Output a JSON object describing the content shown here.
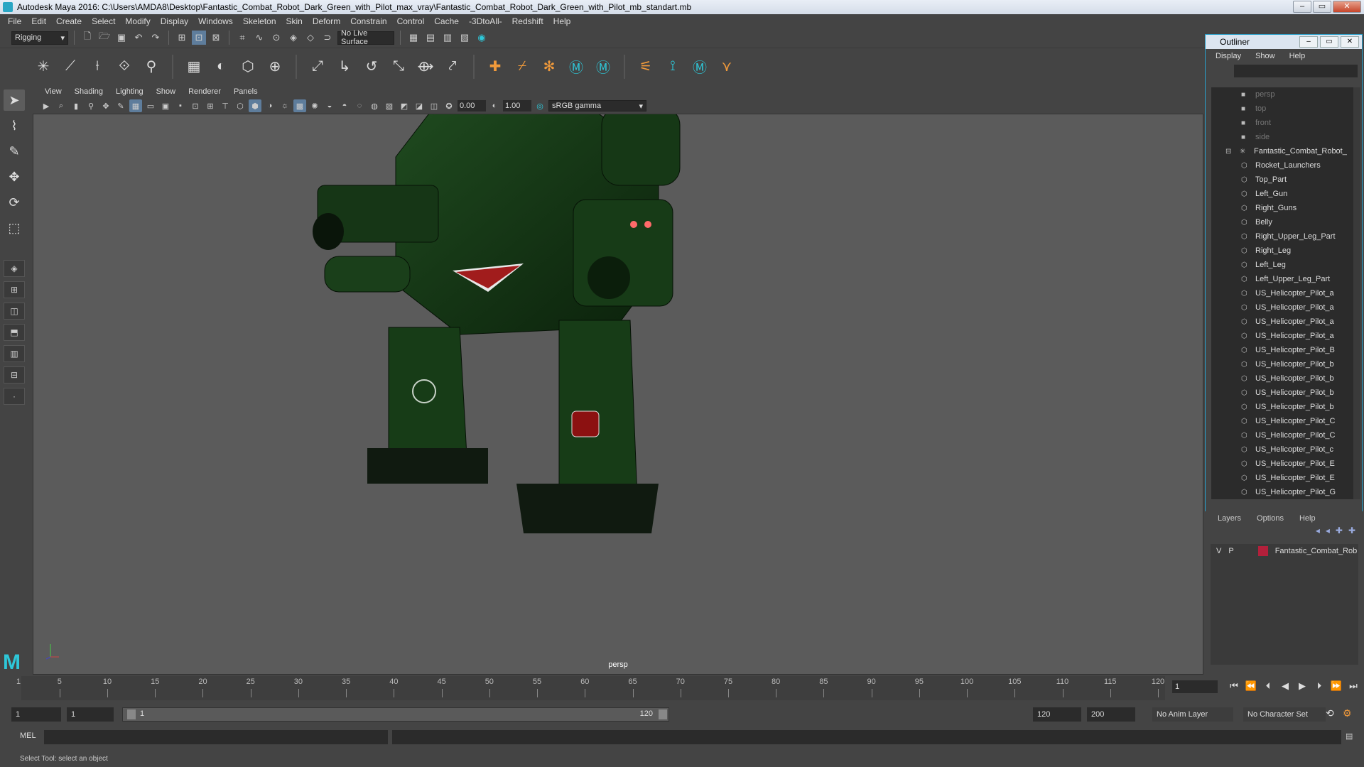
{
  "window": {
    "title": "Autodesk Maya 2016: C:\\Users\\AMDA8\\Desktop\\Fantastic_Combat_Robot_Dark_Green_with_Pilot_max_vray\\Fantastic_Combat_Robot_Dark_Green_with_Pilot_mb_standart.mb",
    "btn_min": "–",
    "btn_max": "▭",
    "btn_close": "✕"
  },
  "menubar": {
    "items": [
      "File",
      "Edit",
      "Create",
      "Select",
      "Modify",
      "Display",
      "Windows",
      "Skeleton",
      "Skin",
      "Deform",
      "Constrain",
      "Control",
      "Cache",
      "-3DtoAll-",
      "Redshift",
      "Help"
    ]
  },
  "statusline": {
    "menuset": "Rigging",
    "live_surface": "No Live Surface"
  },
  "viewport": {
    "menu": [
      "View",
      "Shading",
      "Lighting",
      "Show",
      "Renderer",
      "Panels"
    ],
    "exposure": "0.00",
    "gamma": "1.00",
    "color_space": "sRGB gamma",
    "camera_label": "persp"
  },
  "timeline": {
    "ticks": [
      "5",
      "10",
      "15",
      "20",
      "25",
      "30",
      "35",
      "40",
      "45",
      "50",
      "55",
      "60",
      "65",
      "70",
      "75",
      "80",
      "85",
      "90",
      "95",
      "100",
      "105",
      "110",
      "115",
      "120"
    ],
    "start_label": "1",
    "current_frame": "1"
  },
  "range": {
    "start": "1",
    "anim_start": "1",
    "slider_start": "1",
    "slider_end": "120",
    "anim_end": "120",
    "end": "200",
    "anim_layer": "No Anim Layer",
    "character_set": "No Character Set"
  },
  "cmdline": {
    "label": "MEL"
  },
  "helpline": {
    "text": "Select Tool: select an object"
  },
  "outliner": {
    "title": "Outliner",
    "menu": [
      "Display",
      "Show",
      "Help"
    ],
    "cameras": [
      "persp",
      "top",
      "front",
      "side"
    ],
    "group": "Fantastic_Combat_Robot_",
    "children": [
      "Rocket_Launchers",
      "Top_Part",
      "Left_Gun",
      "Right_Guns",
      "Belly",
      "Right_Upper_Leg_Part",
      "Right_Leg",
      "Left_Leg",
      "Left_Upper_Leg_Part",
      "US_Helicopter_Pilot_a",
      "US_Helicopter_Pilot_a",
      "US_Helicopter_Pilot_a",
      "US_Helicopter_Pilot_a",
      "US_Helicopter_Pilot_B",
      "US_Helicopter_Pilot_b",
      "US_Helicopter_Pilot_b",
      "US_Helicopter_Pilot_b",
      "US_Helicopter_Pilot_b",
      "US_Helicopter_Pilot_C",
      "US_Helicopter_Pilot_C",
      "US_Helicopter_Pilot_c",
      "US_Helicopter_Pilot_E",
      "US_Helicopter_Pilot_E",
      "US_Helicopter_Pilot_G"
    ]
  },
  "layers": {
    "menu": [
      "Layers",
      "Options",
      "Help"
    ],
    "row": {
      "v": "V",
      "p": "P",
      "name": "Fantastic_Combat_Rob",
      "color": "#b3203b"
    }
  }
}
